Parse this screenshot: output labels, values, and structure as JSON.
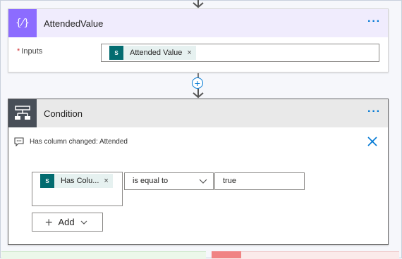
{
  "colors": {
    "variable_accent": "#8c6cff",
    "variable_header_bg": "#f0ecfd",
    "condition_accent": "#484f58",
    "condition_header_bg": "#e9e9e9",
    "link_blue": "#0078d4",
    "sharepoint_teal": "#036c70"
  },
  "variable_card": {
    "icon": "variable-braces-icon",
    "icon_glyph": "{⁄}",
    "title": "AttendedValue",
    "menu_glyph": "···",
    "required_mark": "*",
    "inputs_label": "Inputs",
    "token": {
      "icon": "sharepoint-icon",
      "icon_text": "S",
      "label": "Attended Value",
      "remove_glyph": "×"
    }
  },
  "connector": {
    "add_glyph": "+"
  },
  "condition_card": {
    "icon": "condition-icon",
    "title": "Condition",
    "menu_glyph": "···",
    "comment_icon": "comment-icon",
    "comment": "Has column changed: Attended",
    "close_icon": "close-icon",
    "left_token": {
      "icon": "sharepoint-icon",
      "icon_text": "S",
      "label": "Has Colu...",
      "remove_glyph": "×"
    },
    "operator": "is equal to",
    "value": "true",
    "add_button": {
      "plus_glyph": "+",
      "label": "Add"
    }
  }
}
